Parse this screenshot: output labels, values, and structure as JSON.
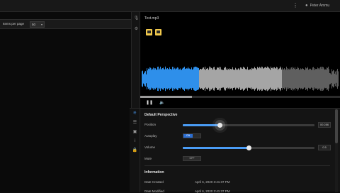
{
  "topbar": {
    "menu_icon": "more-vertical-icon",
    "user_icon": "user-icon",
    "user_name": "Peter Ammu"
  },
  "left_panel": {
    "items_per_page_label": "Items per page",
    "items_per_page_value": "50"
  },
  "rail": {
    "icons": [
      "microphone-icon",
      "gear-icon"
    ]
  },
  "player": {
    "file_title": "Test.mp3",
    "thumb_icons": [
      "thumbnail-icon",
      "thumbnail-icon"
    ],
    "played_fraction": 0.29,
    "progress_fraction": 0.26,
    "pause_icon": "pause-icon",
    "volume_icon": "volume-icon",
    "waveform_colors": {
      "played": "#2e8fea",
      "buffered": "#a5a5a5",
      "remaining": "#5f5f5f"
    }
  },
  "properties": {
    "rail_icons": [
      "sliders-icon",
      "list-icon",
      "image-icon",
      "info-icon",
      "lock-icon"
    ],
    "section_title": "Default Perspective",
    "position_label": "Position",
    "position_value": "00:286",
    "position_fraction": 0.28,
    "autoplay_label": "Autoplay",
    "autoplay_toggle": "ON",
    "volume_label": "Volume",
    "volume_value": "0.5",
    "volume_fraction": 0.5,
    "mute_label": "Mute",
    "mute_button": "OFF",
    "info_title": "Information",
    "date_created_label": "Date Created",
    "date_created_value": "April 6, 2020 3:41:37 PM",
    "date_modified_label": "Date Modified",
    "date_modified_value": "April 6, 2020 3:41:37 PM"
  },
  "colors": {
    "accent": "#4a9cf5",
    "background": "#000000",
    "panel": "#141414"
  }
}
